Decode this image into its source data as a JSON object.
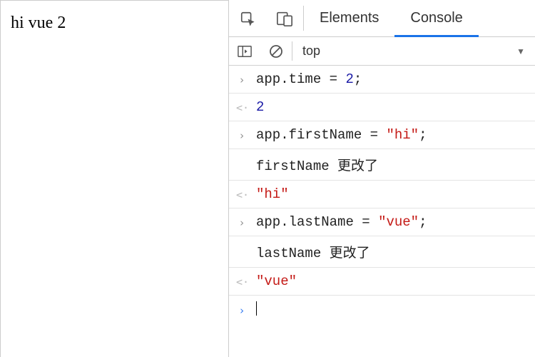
{
  "page": {
    "text": "hi vue 2"
  },
  "tabs": {
    "elements": "Elements",
    "console": "Console"
  },
  "contextSelector": {
    "value": "top"
  },
  "console": {
    "lines": [
      {
        "kind": "input",
        "segments": [
          [
            "id",
            "app"
          ],
          [
            "op",
            "."
          ],
          [
            "id",
            "time"
          ],
          [
            "op",
            " = "
          ],
          [
            "num",
            "2"
          ],
          [
            "op",
            ";"
          ]
        ]
      },
      {
        "kind": "result",
        "segments": [
          [
            "num",
            "2"
          ]
        ]
      },
      {
        "kind": "input",
        "segments": [
          [
            "id",
            "app"
          ],
          [
            "op",
            "."
          ],
          [
            "id",
            "firstName"
          ],
          [
            "op",
            " = "
          ],
          [
            "str",
            "\"hi\""
          ],
          [
            "op",
            ";"
          ]
        ]
      },
      {
        "kind": "log",
        "text": "firstName 更改了"
      },
      {
        "kind": "result",
        "segments": [
          [
            "str",
            "\"hi\""
          ]
        ]
      },
      {
        "kind": "input",
        "segments": [
          [
            "id",
            "app"
          ],
          [
            "op",
            "."
          ],
          [
            "id",
            "lastName"
          ],
          [
            "op",
            " = "
          ],
          [
            "str",
            "\"vue\""
          ],
          [
            "op",
            ";"
          ]
        ]
      },
      {
        "kind": "log",
        "text": "lastName 更改了"
      },
      {
        "kind": "result",
        "segments": [
          [
            "str",
            "\"vue\""
          ]
        ]
      },
      {
        "kind": "prompt"
      }
    ]
  }
}
